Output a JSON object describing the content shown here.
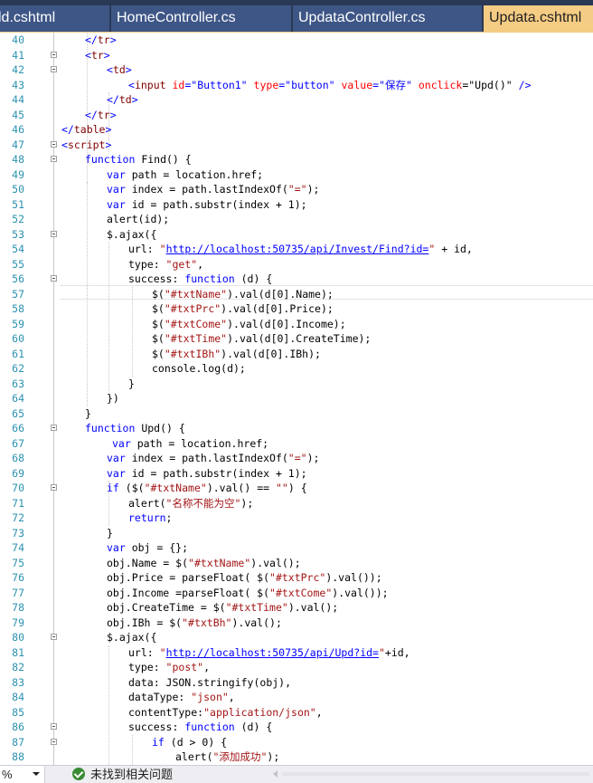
{
  "tabs": [
    {
      "label": "ld.cshtml",
      "active": false
    },
    {
      "label": "HomeController.cs",
      "active": false
    },
    {
      "label": "UpdataController.cs",
      "active": false
    },
    {
      "label": "Updata.cshtml",
      "active": true
    }
  ],
  "colors": {
    "tab_bar": "#293955",
    "tab_inactive": "#3e5686",
    "tab_active": "#f5cc84",
    "line_number": "#2b91af",
    "keyword": "#0000ff",
    "string": "#a31515",
    "html_attribute": "#ff0000",
    "html_tag": "#800000",
    "status_ok": "#388a34"
  },
  "editor": {
    "lines": [
      {
        "n": "40",
        "tokens": [
          {
            "c": "k",
            "t": "</"
          },
          {
            "c": "t",
            "t": "tr"
          },
          {
            "c": "k",
            "t": ">"
          }
        ]
      },
      {
        "n": "41",
        "tokens": [
          {
            "c": "k",
            "t": "<"
          },
          {
            "c": "t",
            "t": "tr"
          },
          {
            "c": "k",
            "t": ">"
          }
        ]
      },
      {
        "n": "42",
        "tokens": [
          {
            "c": "k",
            "t": "<"
          },
          {
            "c": "t",
            "t": "td"
          },
          {
            "c": "k",
            "t": ">"
          }
        ]
      },
      {
        "n": "43",
        "tokens": [
          {
            "c": "k",
            "t": "<"
          },
          {
            "c": "t",
            "t": "input"
          },
          {
            "c": "",
            "t": " "
          },
          {
            "c": "a",
            "t": "id"
          },
          {
            "c": "k",
            "t": "=\"Button1\""
          },
          {
            "c": "",
            "t": " "
          },
          {
            "c": "a",
            "t": "type"
          },
          {
            "c": "k",
            "t": "=\"button\""
          },
          {
            "c": "",
            "t": " "
          },
          {
            "c": "a",
            "t": "value"
          },
          {
            "c": "k",
            "t": "=\"保存\""
          },
          {
            "c": "",
            "t": " "
          },
          {
            "c": "a",
            "t": "onclick"
          },
          {
            "c": "",
            "t": "=\"Upd()\""
          },
          {
            "c": "",
            "t": " "
          },
          {
            "c": "k",
            "t": "/>"
          }
        ]
      },
      {
        "n": "44",
        "tokens": [
          {
            "c": "k",
            "t": "</"
          },
          {
            "c": "t",
            "t": "td"
          },
          {
            "c": "k",
            "t": ">"
          }
        ]
      },
      {
        "n": "45",
        "tokens": [
          {
            "c": "k",
            "t": "</"
          },
          {
            "c": "t",
            "t": "tr"
          },
          {
            "c": "k",
            "t": ">"
          }
        ]
      },
      {
        "n": "46",
        "tokens": [
          {
            "c": "k",
            "t": "</"
          },
          {
            "c": "t",
            "t": "table"
          },
          {
            "c": "k",
            "t": ">"
          }
        ]
      },
      {
        "n": "47",
        "tokens": [
          {
            "c": "k",
            "t": "<"
          },
          {
            "c": "t",
            "t": "script"
          },
          {
            "c": "k",
            "t": ">"
          }
        ]
      },
      {
        "n": "48",
        "tokens": [
          {
            "c": "k",
            "t": "function"
          },
          {
            "c": "",
            "t": " Find() {"
          }
        ]
      },
      {
        "n": "49",
        "tokens": [
          {
            "c": "k",
            "t": "var"
          },
          {
            "c": "",
            "t": " path = location.href;"
          }
        ]
      },
      {
        "n": "50",
        "tokens": [
          {
            "c": "k",
            "t": "var"
          },
          {
            "c": "",
            "t": " index = path.lastIndexOf("
          },
          {
            "c": "s",
            "t": "\"=\""
          },
          {
            "c": "",
            "t": ");"
          }
        ]
      },
      {
        "n": "51",
        "tokens": [
          {
            "c": "k",
            "t": "var"
          },
          {
            "c": "",
            "t": " id = path.substr(index + 1);"
          }
        ]
      },
      {
        "n": "52",
        "tokens": [
          {
            "c": "",
            "t": "alert(id);"
          }
        ]
      },
      {
        "n": "53",
        "tokens": [
          {
            "c": "",
            "t": "$.ajax({"
          }
        ]
      },
      {
        "n": "54",
        "tokens": [
          {
            "c": "",
            "t": "url: "
          },
          {
            "c": "s",
            "t": "\""
          },
          {
            "c": "u",
            "t": "http://localhost:50735/api/Invest/Find?id="
          },
          {
            "c": "s",
            "t": "\""
          },
          {
            "c": "",
            "t": " + id,"
          }
        ]
      },
      {
        "n": "55",
        "tokens": [
          {
            "c": "",
            "t": "type: "
          },
          {
            "c": "s",
            "t": "\"get\""
          },
          {
            "c": "",
            "t": ","
          }
        ]
      },
      {
        "n": "56",
        "tokens": [
          {
            "c": "",
            "t": "success: "
          },
          {
            "c": "k",
            "t": "function"
          },
          {
            "c": "",
            "t": " (d) {"
          }
        ]
      },
      {
        "n": "57",
        "tokens": [
          {
            "c": "",
            "t": "$("
          },
          {
            "c": "s",
            "t": "\"#txtName\""
          },
          {
            "c": "",
            "t": ").val(d[0].Name);"
          }
        ]
      },
      {
        "n": "58",
        "tokens": [
          {
            "c": "",
            "t": "$("
          },
          {
            "c": "s",
            "t": "\"#txtPrc\""
          },
          {
            "c": "",
            "t": ").val(d[0].Price);"
          }
        ]
      },
      {
        "n": "59",
        "tokens": [
          {
            "c": "",
            "t": "$("
          },
          {
            "c": "s",
            "t": "\"#txtCome\""
          },
          {
            "c": "",
            "t": ").val(d[0].Income);"
          }
        ]
      },
      {
        "n": "60",
        "tokens": [
          {
            "c": "",
            "t": "$("
          },
          {
            "c": "s",
            "t": "\"#txtTime\""
          },
          {
            "c": "",
            "t": ").val(d[0].CreateTime);"
          }
        ]
      },
      {
        "n": "61",
        "tokens": [
          {
            "c": "",
            "t": "$("
          },
          {
            "c": "s",
            "t": "\"#txtIBh\""
          },
          {
            "c": "",
            "t": ").val(d[0].IBh);"
          }
        ]
      },
      {
        "n": "62",
        "tokens": [
          {
            "c": "",
            "t": "console.log(d);"
          }
        ]
      },
      {
        "n": "63",
        "tokens": [
          {
            "c": "",
            "t": "}"
          }
        ]
      },
      {
        "n": "64",
        "tokens": [
          {
            "c": "",
            "t": "})"
          }
        ]
      },
      {
        "n": "65",
        "tokens": [
          {
            "c": "",
            "t": "}"
          }
        ]
      },
      {
        "n": "66",
        "tokens": [
          {
            "c": "k",
            "t": "function"
          },
          {
            "c": "",
            "t": " Upd() {"
          }
        ]
      },
      {
        "n": "67",
        "tokens": [
          {
            "c": "k",
            "t": "var"
          },
          {
            "c": "",
            "t": " path = location.href;"
          }
        ]
      },
      {
        "n": "68",
        "tokens": [
          {
            "c": "k",
            "t": "var"
          },
          {
            "c": "",
            "t": " index = path.lastIndexOf("
          },
          {
            "c": "s",
            "t": "\"=\""
          },
          {
            "c": "",
            "t": ");"
          }
        ]
      },
      {
        "n": "69",
        "tokens": [
          {
            "c": "k",
            "t": "var"
          },
          {
            "c": "",
            "t": " id = path.substr(index + 1);"
          }
        ]
      },
      {
        "n": "70",
        "tokens": [
          {
            "c": "k",
            "t": "if"
          },
          {
            "c": "",
            "t": " ($("
          },
          {
            "c": "s",
            "t": "\"#txtName\""
          },
          {
            "c": "",
            "t": ").val() == "
          },
          {
            "c": "s",
            "t": "\"\""
          },
          {
            "c": "",
            "t": ") {"
          }
        ]
      },
      {
        "n": "71",
        "tokens": [
          {
            "c": "",
            "t": "alert("
          },
          {
            "c": "s",
            "t": "\"名称不能为空\""
          },
          {
            "c": "",
            "t": ");"
          }
        ]
      },
      {
        "n": "72",
        "tokens": [
          {
            "c": "k",
            "t": "return"
          },
          {
            "c": "",
            "t": ";"
          }
        ]
      },
      {
        "n": "73",
        "tokens": [
          {
            "c": "",
            "t": "}"
          }
        ]
      },
      {
        "n": "74",
        "tokens": [
          {
            "c": "k",
            "t": "var"
          },
          {
            "c": "",
            "t": " obj = {};"
          }
        ]
      },
      {
        "n": "75",
        "tokens": [
          {
            "c": "",
            "t": "obj.Name = $("
          },
          {
            "c": "s",
            "t": "\"#txtName\""
          },
          {
            "c": "",
            "t": ").val();"
          }
        ]
      },
      {
        "n": "76",
        "tokens": [
          {
            "c": "",
            "t": "obj.Price = parseFloat( $("
          },
          {
            "c": "s",
            "t": "\"#txtPrc\""
          },
          {
            "c": "",
            "t": ").val());"
          }
        ]
      },
      {
        "n": "77",
        "tokens": [
          {
            "c": "",
            "t": "obj.Income =parseFloat( $("
          },
          {
            "c": "s",
            "t": "\"#txtCome\""
          },
          {
            "c": "",
            "t": ").val());"
          }
        ]
      },
      {
        "n": "78",
        "tokens": [
          {
            "c": "",
            "t": "obj.CreateTime = $("
          },
          {
            "c": "s",
            "t": "\"#txtTime\""
          },
          {
            "c": "",
            "t": ").val();"
          }
        ]
      },
      {
        "n": "79",
        "tokens": [
          {
            "c": "",
            "t": "obj.IBh = $("
          },
          {
            "c": "s",
            "t": "\"#txtBh\""
          },
          {
            "c": "",
            "t": ").val();"
          }
        ]
      },
      {
        "n": "80",
        "tokens": [
          {
            "c": "",
            "t": "$.ajax({"
          }
        ]
      },
      {
        "n": "81",
        "tokens": [
          {
            "c": "",
            "t": "url: "
          },
          {
            "c": "s",
            "t": "\""
          },
          {
            "c": "u",
            "t": "http://localhost:50735/api/Upd?id="
          },
          {
            "c": "s",
            "t": "\""
          },
          {
            "c": "",
            "t": "+id,"
          }
        ]
      },
      {
        "n": "82",
        "tokens": [
          {
            "c": "",
            "t": "type: "
          },
          {
            "c": "s",
            "t": "\"post\""
          },
          {
            "c": "",
            "t": ","
          }
        ]
      },
      {
        "n": "83",
        "tokens": [
          {
            "c": "",
            "t": "data: JSON.stringify(obj),"
          }
        ]
      },
      {
        "n": "84",
        "tokens": [
          {
            "c": "",
            "t": "dataType: "
          },
          {
            "c": "s",
            "t": "\"json\""
          },
          {
            "c": "",
            "t": ","
          }
        ]
      },
      {
        "n": "85",
        "tokens": [
          {
            "c": "",
            "t": "contentType:"
          },
          {
            "c": "s",
            "t": "\"application/json\""
          },
          {
            "c": "",
            "t": ","
          }
        ]
      },
      {
        "n": "86",
        "tokens": [
          {
            "c": "",
            "t": "success: "
          },
          {
            "c": "k",
            "t": "function"
          },
          {
            "c": "",
            "t": " (d) {"
          }
        ]
      },
      {
        "n": "87",
        "tokens": [
          {
            "c": "k",
            "t": "if"
          },
          {
            "c": "",
            "t": " (d > 0) {"
          }
        ]
      },
      {
        "n": "88",
        "tokens": [
          {
            "c": "",
            "t": "alert("
          },
          {
            "c": "s",
            "t": "\"添加成功\""
          },
          {
            "c": "",
            "t": ");"
          }
        ]
      }
    ]
  },
  "status_bar": {
    "zoom_label": "%",
    "issues_label": "未找到相关问题",
    "issues_icon": "check-circle-icon"
  }
}
